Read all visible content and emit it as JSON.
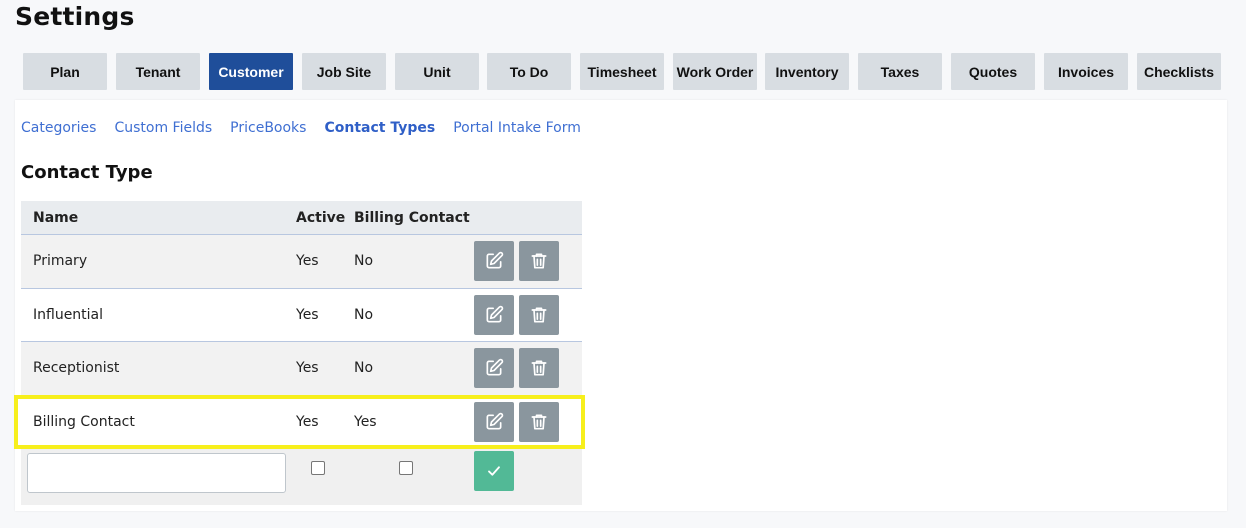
{
  "page": {
    "title": "Settings"
  },
  "tabs": [
    {
      "label": "Plan"
    },
    {
      "label": "Tenant"
    },
    {
      "label": "Customer",
      "active": true
    },
    {
      "label": "Job Site"
    },
    {
      "label": "Unit"
    },
    {
      "label": "To Do"
    },
    {
      "label": "Timesheet"
    },
    {
      "label": "Work Order"
    },
    {
      "label": "Inventory"
    },
    {
      "label": "Taxes"
    },
    {
      "label": "Quotes"
    },
    {
      "label": "Invoices"
    },
    {
      "label": "Checklists"
    }
  ],
  "subnav": [
    {
      "label": "Categories"
    },
    {
      "label": "Custom Fields"
    },
    {
      "label": "PriceBooks"
    },
    {
      "label": "Contact Types",
      "active": true
    },
    {
      "label": "Portal Intake Form"
    }
  ],
  "section": {
    "title": "Contact Type"
  },
  "table": {
    "headers": {
      "name": "Name",
      "active": "Active",
      "billing": "Billing Contact"
    },
    "rows": [
      {
        "name": "Primary",
        "active": "Yes",
        "billing": "No"
      },
      {
        "name": "Influential",
        "active": "Yes",
        "billing": "No"
      },
      {
        "name": "Receptionist",
        "active": "Yes",
        "billing": "No"
      },
      {
        "name": "Billing Contact",
        "active": "Yes",
        "billing": "Yes",
        "highlighted": true
      }
    ]
  },
  "new_row": {
    "name_value": "",
    "active_checked": false,
    "billing_checked": false
  },
  "icons": {
    "edit": "edit-icon",
    "delete": "trash-icon",
    "confirm": "check-icon"
  },
  "colors": {
    "accent": "#1f4e9a",
    "link": "#3f6fd2",
    "action_button": "#8a969e",
    "confirm_button": "#52b996",
    "highlight": "#f7ef1c"
  }
}
